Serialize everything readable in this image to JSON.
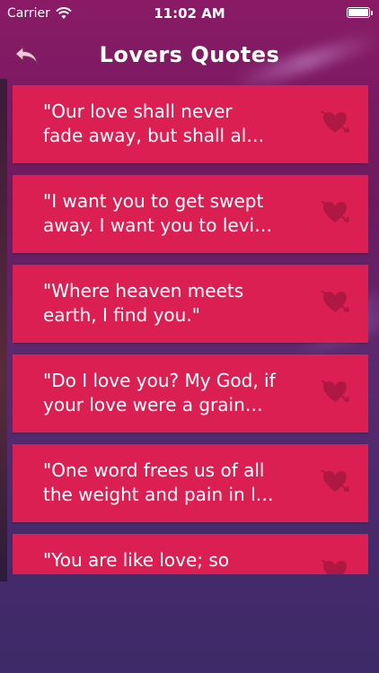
{
  "status_bar": {
    "carrier": "Carrier",
    "time": "11:02 AM"
  },
  "nav": {
    "title": "Lovers Quotes",
    "back_icon": "back-arrow-icon"
  },
  "quotes": [
    {
      "text": "\"Our love shall never\nfade away, but shall al…"
    },
    {
      "text": "\"I want you to get swept\naway. I want you to levi…"
    },
    {
      "text": "\"Where heaven meets\nearth, I find you.\""
    },
    {
      "text": "\"Do I love you? My God, if\nyour love were a grain…"
    },
    {
      "text": "\"One word frees us of all\nthe weight and pain in l…"
    },
    {
      "text": "\"You are like love; so"
    }
  ],
  "colors": {
    "card": "#dc1f52",
    "heart": "#b01844"
  }
}
